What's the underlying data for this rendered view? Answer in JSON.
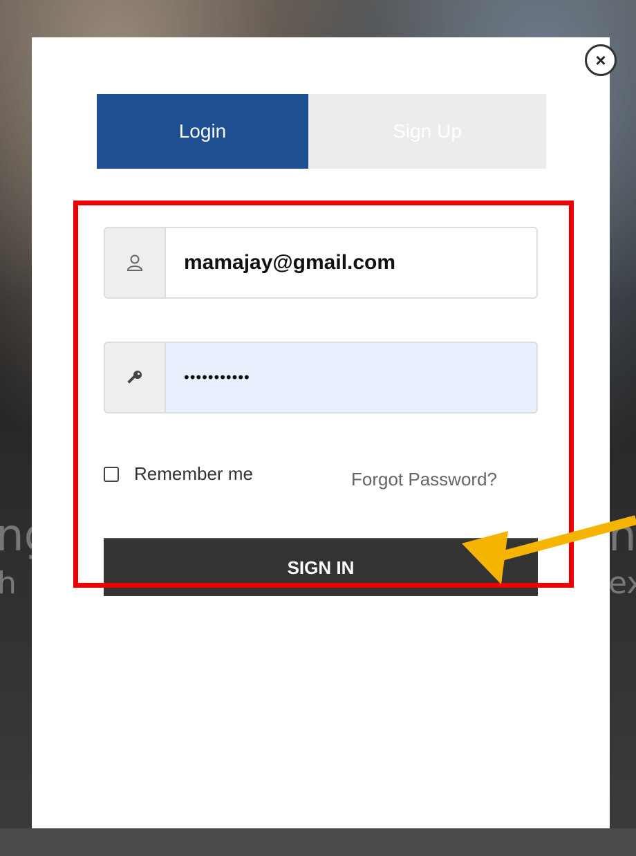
{
  "background": {
    "left_line1": "ng",
    "left_line2": "h",
    "right_line1": "ng",
    "right_line2": "ex"
  },
  "modal": {
    "close_icon": "×",
    "tabs": [
      {
        "label": "Login",
        "active": true
      },
      {
        "label": "Sign Up",
        "active": false
      }
    ],
    "email": {
      "icon": "user-icon",
      "value": "mamajay@gmail.com"
    },
    "password": {
      "icon": "key-icon",
      "value": "•••••••••••"
    },
    "remember_label": "Remember me",
    "forgot_label": "Forgot Password?",
    "signin_label": "SIGN IN"
  },
  "colors": {
    "login_tab": "#1e4f91",
    "highlight_box": "#ee0000",
    "arrow": "#f5b400",
    "signin_button": "#333333"
  }
}
